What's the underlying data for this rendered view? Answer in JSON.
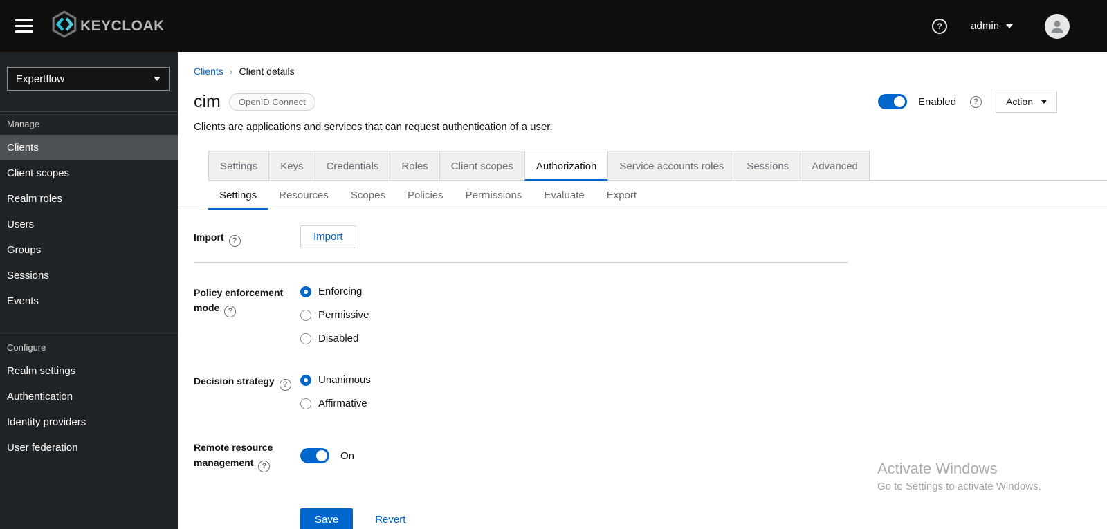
{
  "icons": {
    "help": "?",
    "breadcrumb_sep": "›"
  },
  "topbar": {
    "brand": "KEYCLOAK",
    "user": "admin"
  },
  "sidebar": {
    "realm": "Expertflow",
    "sections": [
      {
        "label": "Manage",
        "items": [
          "Clients",
          "Client scopes",
          "Realm roles",
          "Users",
          "Groups",
          "Sessions",
          "Events"
        ],
        "active_item": "Clients"
      },
      {
        "label": "Configure",
        "items": [
          "Realm settings",
          "Authentication",
          "Identity providers",
          "User federation"
        ]
      }
    ]
  },
  "breadcrumb": {
    "parent": "Clients",
    "current": "Client details"
  },
  "client": {
    "title": "cim",
    "protocol_badge": "OpenID Connect",
    "description": "Clients are applications and services that can request authentication of a user.",
    "enabled_label": "Enabled",
    "enabled": true,
    "action_label": "Action"
  },
  "tabs": {
    "main": [
      "Settings",
      "Keys",
      "Credentials",
      "Roles",
      "Client scopes",
      "Authorization",
      "Service accounts roles",
      "Sessions",
      "Advanced"
    ],
    "main_active": "Authorization",
    "sub": [
      "Settings",
      "Resources",
      "Scopes",
      "Policies",
      "Permissions",
      "Evaluate",
      "Export"
    ],
    "sub_active": "Settings"
  },
  "form": {
    "import": {
      "label": "Import",
      "button_label": "Import"
    },
    "policy_enforcement_mode": {
      "label": "Policy enforcement mode",
      "options": [
        "Enforcing",
        "Permissive",
        "Disabled"
      ],
      "selected": "Enforcing"
    },
    "decision_strategy": {
      "label": "Decision strategy",
      "options": [
        "Unanimous",
        "Affirmative"
      ],
      "selected": "Unanimous"
    },
    "remote_resource_management": {
      "label": "Remote resource management",
      "state_label": "On",
      "enabled": true
    },
    "save_label": "Save",
    "revert_label": "Revert"
  },
  "watermark": {
    "line1": "Activate Windows",
    "line2": "Go to Settings to activate Windows."
  }
}
